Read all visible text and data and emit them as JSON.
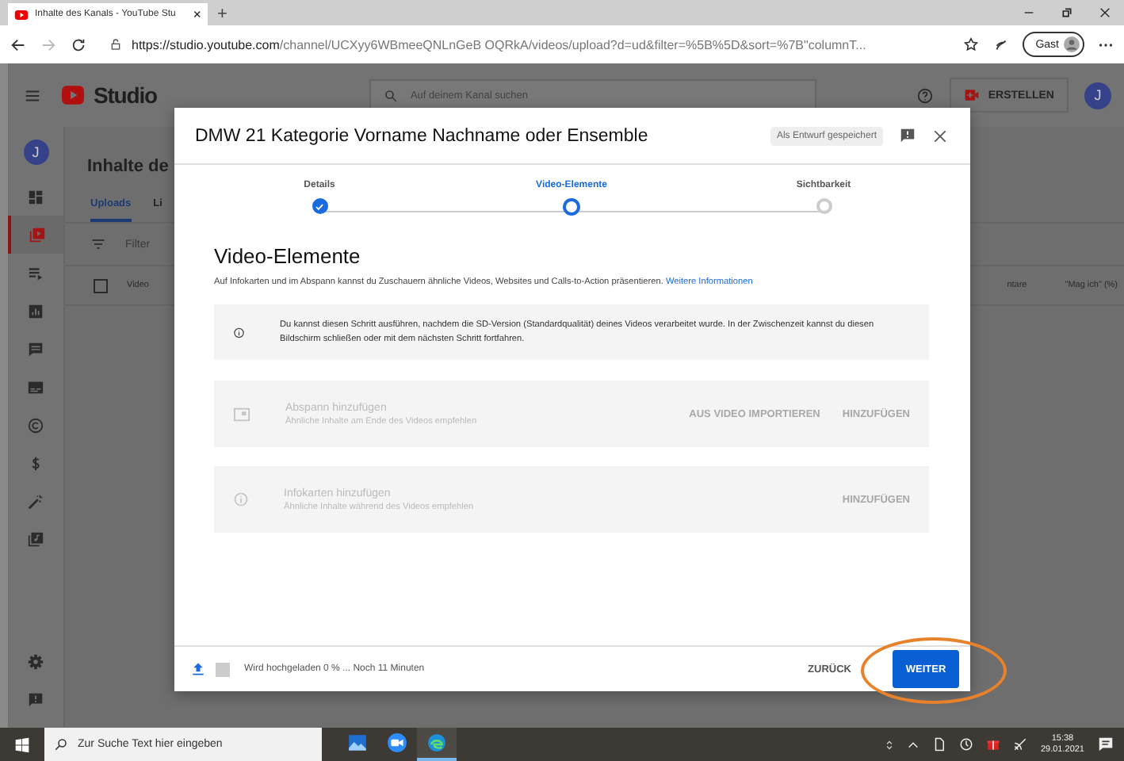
{
  "browser": {
    "tab_title": "Inhalte des Kanals - YouTube Stu",
    "tab_close": "×",
    "new_tab": "+",
    "url": "**https://studio.youtube.com**/channel/UCXyy6WBmeeQNLnGeB OQRkA/videos/upload?d=ud&filter=%5B%5D&sort=%7B\"columnT...",
    "profile": "Gast"
  },
  "studio": {
    "logo": "Studio",
    "search_placeholder": "Auf deinem Kanal suchen",
    "create": "ERSTELLEN",
    "avatar": "J"
  },
  "sidebar": {
    "avatar": "J",
    "items": [
      {
        "kind": "dashboard",
        "selected": false
      },
      {
        "kind": "content",
        "selected": true
      },
      {
        "kind": "playlists",
        "selected": false
      },
      {
        "kind": "analytics",
        "selected": false
      },
      {
        "kind": "comments",
        "selected": false
      },
      {
        "kind": "subtitles",
        "selected": false
      },
      {
        "kind": "copyright",
        "selected": false
      },
      {
        "kind": "monetization",
        "selected": false
      },
      {
        "kind": "customization",
        "selected": false
      },
      {
        "kind": "library",
        "selected": false
      }
    ],
    "bottom": [
      {
        "kind": "settings"
      },
      {
        "kind": "feedback"
      }
    ]
  },
  "page": {
    "title": "Inhalte de",
    "tabs": [
      {
        "label": "Uploads",
        "selected": true
      },
      {
        "label": "Li",
        "selected": false
      }
    ],
    "filter": "Filter",
    "select_all": {
      "checked": false
    },
    "columns": [
      "Video",
      "ntare",
      "\"Mag ich\" (%)"
    ]
  },
  "dialog": {
    "title": "DMW 21 Kategorie Vorname Nachname oder Ensemble",
    "draft_status": "Als Entwurf gespeichert",
    "steps": [
      {
        "label": "Details",
        "completed": true,
        "selected": false
      },
      {
        "label": "Video-Elemente",
        "completed": false,
        "selected": true
      },
      {
        "label": "Sichtbarkeit",
        "completed": false,
        "selected": false
      }
    ],
    "heading": "Video-Elemente",
    "description": "Auf Infokarten und im Abspann kannst du Zuschauern ähnliche Videos, Websites und Calls-to-Action präsentieren.",
    "link": "Weitere Informationen",
    "notice": "Du kannst diesen Schritt ausführen, nachdem die SD-Version (Standardqualität) deines Videos verarbeitet wurde. In der Zwischenzeit kannst du diesen Bildschirm schließen oder mit dem nächsten Schritt fortfahren.",
    "cards": [
      {
        "kind": "endscreen",
        "disabled": true,
        "title": "Abspann hinzufügen",
        "subtitle": "Ähnliche Inhalte am Ende des Videos empfehlen",
        "actions": [
          "AUS VIDEO IMPORTIEREN",
          "HINZUFÜGEN"
        ]
      },
      {
        "kind": "infocards",
        "disabled": true,
        "title": "Infokarten hinzufügen",
        "subtitle": "Ähnliche Inhalte während des Videos empfehlen",
        "actions": [
          "HINZUFÜGEN"
        ]
      }
    ],
    "upload_status": "Wird hochgeladen 0 % ... Noch 11 Minuten",
    "back": "ZURÜCK",
    "next": "WEITER"
  },
  "taskbar": {
    "search_placeholder": "Zur Suche Text hier eingeben",
    "apps": [
      {
        "kind": "photos",
        "running": false
      },
      {
        "kind": "zoom",
        "running": false
      },
      {
        "kind": "edge",
        "running": true
      }
    ],
    "time": "15:38",
    "date": "29.01.2021"
  }
}
